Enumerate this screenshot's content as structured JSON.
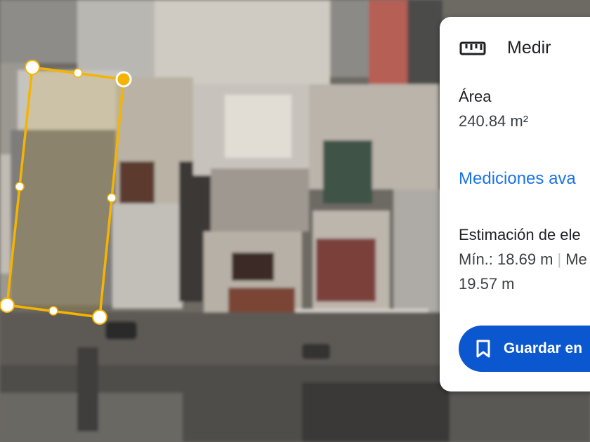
{
  "panel": {
    "icon": "ruler-icon",
    "title": "Medir",
    "area_label": "Área",
    "area_value": "240.84 m²",
    "advanced_link": "Mediciones ava",
    "elevation_label": "Estimación de ele",
    "elevation_min": "Mín.: 18.69 m",
    "elevation_next": "Me",
    "elevation_value2": "19.57 m",
    "save_button": {
      "icon": "bookmark-icon",
      "label": "Guardar en"
    }
  },
  "colors": {
    "outline": "#f5b400",
    "link": "#1a73e8",
    "button": "#0b57d0"
  }
}
